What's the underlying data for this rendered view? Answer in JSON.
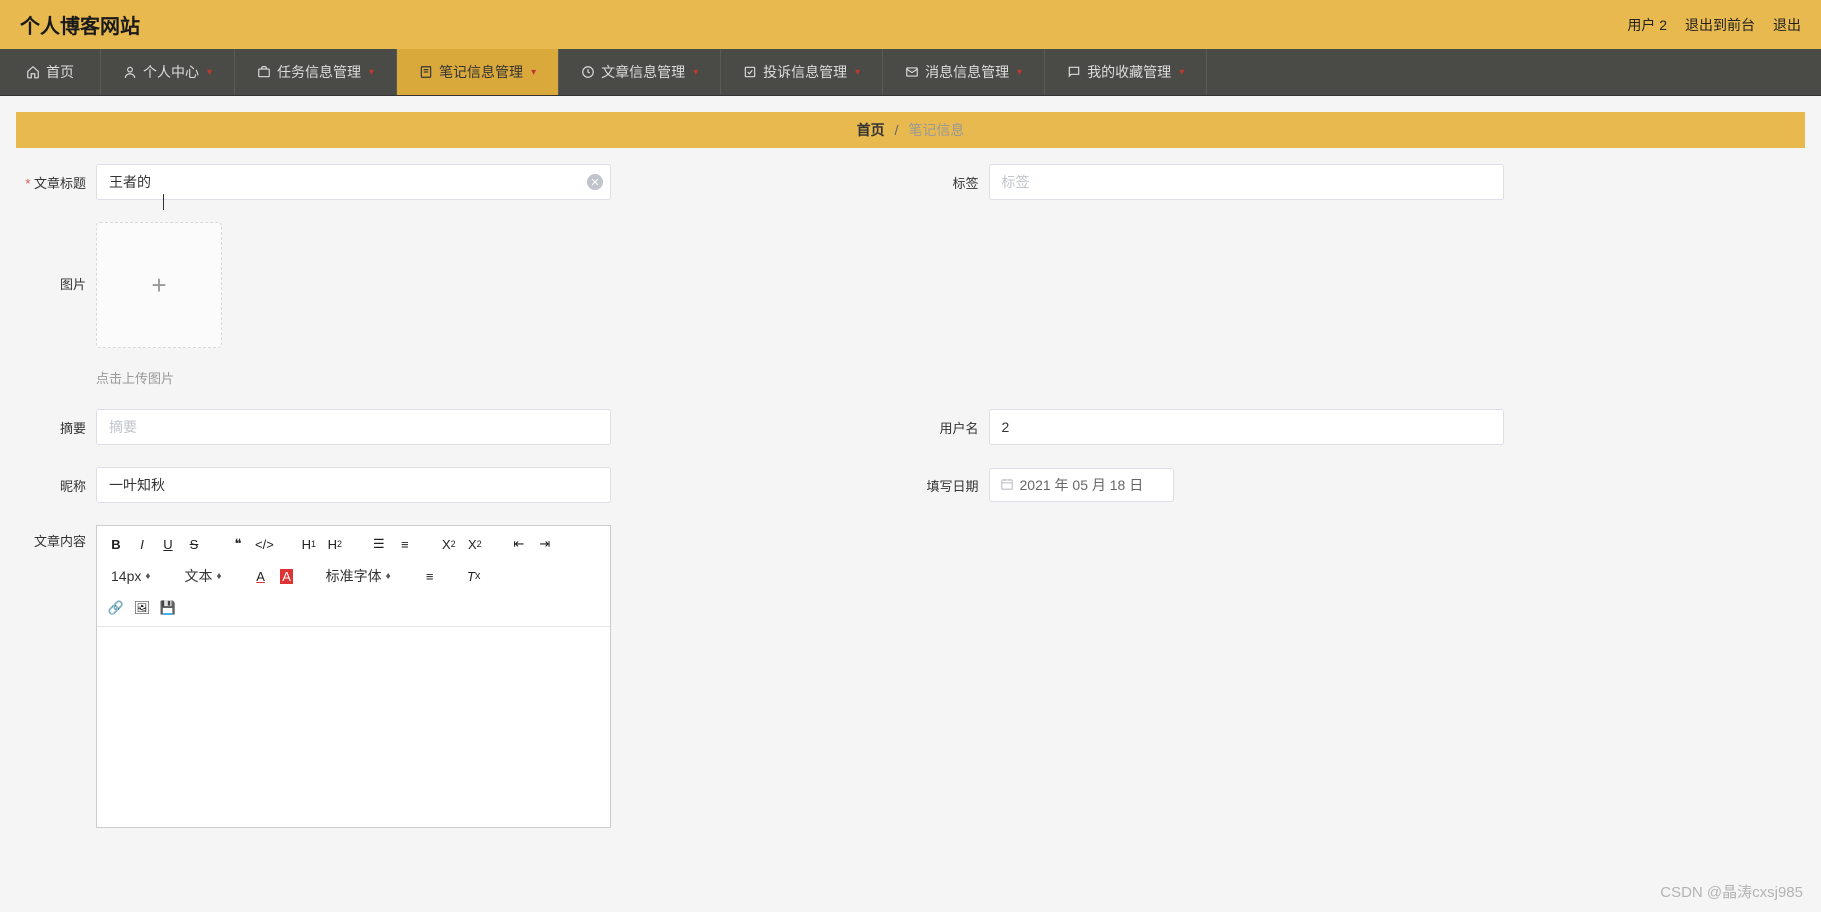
{
  "header": {
    "site_title": "个人博客网站",
    "user_label": "用户 2",
    "exit_front": "退出到前台",
    "exit": "退出"
  },
  "nav": {
    "home": "首页",
    "personal": "个人中心",
    "task": "任务信息管理",
    "note": "笔记信息管理",
    "article": "文章信息管理",
    "complaint": "投诉信息管理",
    "message": "消息信息管理",
    "favorite": "我的收藏管理"
  },
  "breadcrumb": {
    "home": "首页",
    "sep": "/",
    "current": "笔记信息"
  },
  "form": {
    "title_label": "文章标题",
    "title_value": "王者的",
    "tag_label": "标签",
    "tag_placeholder": "标签",
    "image_label": "图片",
    "upload_hint": "点击上传图片",
    "summary_label": "摘要",
    "summary_placeholder": "摘要",
    "username_label": "用户名",
    "username_value": "2",
    "nickname_label": "昵称",
    "nickname_value": "一叶知秋",
    "date_label": "填写日期",
    "date_value": "2021 年 05 月 18 日",
    "content_label": "文章内容"
  },
  "editor": {
    "font_size": "14px",
    "text_style": "文本",
    "font_family": "标准字体"
  },
  "watermark": "CSDN @晶涛cxsj985"
}
